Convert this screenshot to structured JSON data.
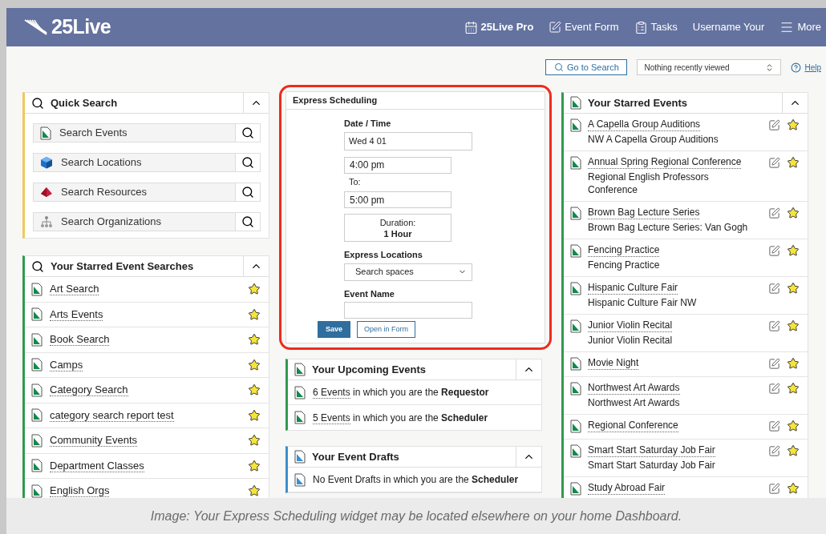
{
  "header": {
    "logo": "25Live",
    "nav": [
      {
        "kind": "pro",
        "label": "25Live Pro"
      },
      {
        "kind": "form",
        "label": "Event Form"
      },
      {
        "kind": "tasks",
        "label": "Tasks"
      },
      {
        "kind": "user",
        "label": "Username Your"
      },
      {
        "kind": "more",
        "label": "More"
      }
    ]
  },
  "toolbar": {
    "go_to_search": "Go to Search",
    "recent": "Nothing recently viewed",
    "help": "Help"
  },
  "quick_search": {
    "title": "Quick Search",
    "items": [
      {
        "kind": "events",
        "label": "Search Events"
      },
      {
        "kind": "locations",
        "label": "Search Locations"
      },
      {
        "kind": "resources",
        "label": "Search Resources"
      },
      {
        "kind": "organizations",
        "label": "Search Organizations"
      }
    ]
  },
  "starred_searches": {
    "title": "Your Starred Event Searches",
    "items": [
      "Art Search",
      "Arts Events",
      "Book Search",
      "Camps",
      "Category Search",
      "category search report test",
      "Community Events",
      "Department Classes",
      "English Orgs"
    ]
  },
  "express": {
    "title": "Express Scheduling",
    "date_label": "Date / Time",
    "date_value": "Wed 4 01",
    "start_time": "4:00 pm",
    "to_label": "To:",
    "end_time": "5:00 pm",
    "duration_label": "Duration:",
    "duration_value": "1 Hour",
    "locations_label": "Express Locations",
    "locations_value": "Search spaces",
    "event_name_label": "Event Name",
    "save": "Save",
    "open_in_form": "Open in Form"
  },
  "upcoming": {
    "title": "Your Upcoming Events",
    "items": [
      {
        "link": "6 Events",
        "text": " in which you are the **Requestor**"
      },
      {
        "link": "5 Events",
        "text": " in which you are the **Scheduler**"
      }
    ]
  },
  "drafts": {
    "title": "Your Event Drafts",
    "items": [
      "No Event Drafts in which you are the **Scheduler**"
    ]
  },
  "starred_events": {
    "title": "Your Starred Events",
    "items": [
      {
        "name": "A Capella Group Auditions",
        "subtitle": "NW A Capella Group Auditions"
      },
      {
        "name": "Annual Spring Regional Conference",
        "subtitle": "Regional English Professors Conference"
      },
      {
        "name": "Brown Bag Lecture Series",
        "subtitle": "Brown Bag Lecture Series: Van Gogh"
      },
      {
        "name": "Fencing Practice",
        "subtitle": "Fencing Practice"
      },
      {
        "name": "Hispanic Culture Fair",
        "subtitle": "Hispanic Culture Fair NW"
      },
      {
        "name": "Junior Violin Recital",
        "subtitle": "Junior Violin Recital"
      },
      {
        "name": "Movie Night"
      },
      {
        "name": "Northwest Art Awards",
        "subtitle": "Northwest Art Awards"
      },
      {
        "name": "Regional Conference"
      },
      {
        "name": "Smart Start Saturday Job Fair",
        "subtitle": "Smart Start Saturday Job Fair"
      },
      {
        "name": "Study Abroad Fair"
      }
    ]
  },
  "caption": "Image: Your Express Scheduling widget may be located elsewhere on your home Dashboard."
}
